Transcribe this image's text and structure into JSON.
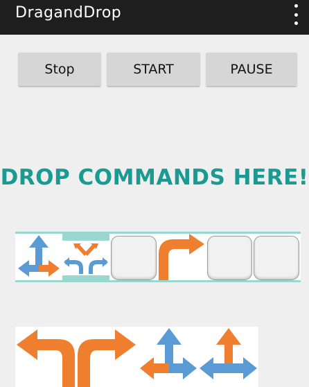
{
  "app": {
    "title": "DragandDrop"
  },
  "toolbar": {
    "stop_label": "Stop",
    "start_label": "START",
    "pause_label": "PAUSE"
  },
  "drop_zone": {
    "label": "DROP COMMANDS HERE!",
    "slots": [
      {
        "content": "up-right-arrow-icon"
      },
      {
        "content": "fork-arrow-icon"
      },
      {
        "content": "empty"
      },
      {
        "content": "turn-right-arrow-icon"
      },
      {
        "content": "empty"
      },
      {
        "content": "empty"
      }
    ]
  },
  "palette": {
    "items": [
      {
        "content": "turn-left-arrow-icon"
      },
      {
        "content": "turn-right-arrow-icon"
      },
      {
        "content": "up-left-arrow-icon"
      },
      {
        "content": "up-left-right-arrow-icon"
      }
    ]
  },
  "colors": {
    "appbar": "#1e1e1e",
    "accent_teal": "#1a9a91",
    "arrow_orange": "#ef7f2e",
    "arrow_blue": "#5a9bd5",
    "strip_line": "#9ad7d0"
  }
}
